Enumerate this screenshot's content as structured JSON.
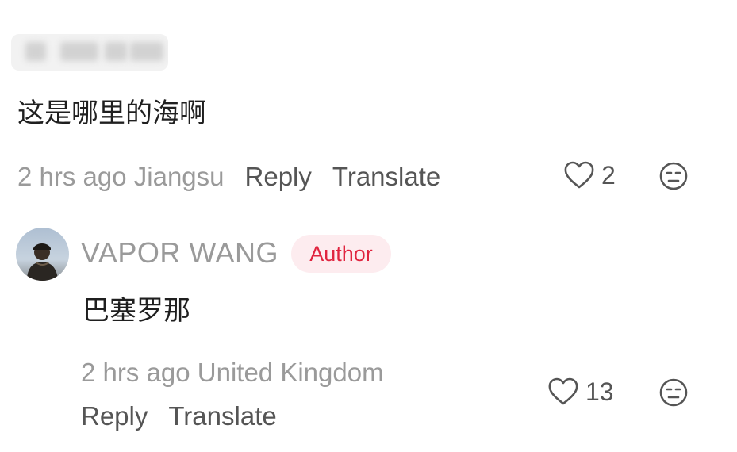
{
  "top_comment": {
    "text": "这是哪里的海啊",
    "time_location": "2 hrs ago Jiangsu",
    "reply_label": "Reply",
    "translate_label": "Translate",
    "like_count": "2",
    "like_icon": "heart-outline-icon",
    "reaction_icon": "neutral-face-icon"
  },
  "reply": {
    "author": "VAPOR WANG",
    "badge": "Author",
    "text": "巴塞罗那",
    "time_location": "2 hrs ago United Kingdom",
    "reply_label": "Reply",
    "translate_label": "Translate",
    "like_count": "13",
    "like_icon": "heart-outline-icon",
    "reaction_icon": "neutral-face-icon"
  },
  "colors": {
    "badge_text": "#e0243f",
    "badge_bg": "#fdecef",
    "muted_text": "#9a9a9a",
    "action_text": "#555555"
  }
}
